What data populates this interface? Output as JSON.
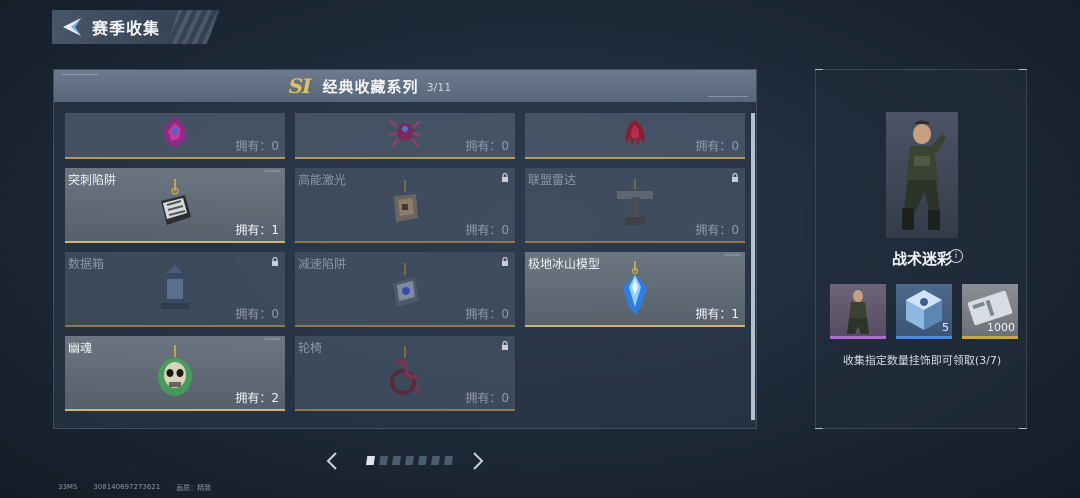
{
  "header": {
    "title": "赛季收集"
  },
  "panel": {
    "season_badge": "SI",
    "series_title": "经典收藏系列",
    "series_count": "3/11"
  },
  "cards": [
    {
      "name": "",
      "owned": "拥有：0",
      "state": "top"
    },
    {
      "name": "",
      "owned": "拥有：0",
      "state": "top"
    },
    {
      "name": "",
      "owned": "拥有：0",
      "state": "top"
    },
    {
      "name": "突刺陷阱",
      "owned": "拥有：1",
      "state": "owned"
    },
    {
      "name": "高能激光",
      "owned": "拥有：0",
      "state": "locked"
    },
    {
      "name": "联盟雷达",
      "owned": "拥有：0",
      "state": "locked"
    },
    {
      "name": "数据箱",
      "owned": "拥有：0",
      "state": "locked"
    },
    {
      "name": "减速陷阱",
      "owned": "拥有：0",
      "state": "locked"
    },
    {
      "name": "极地冰山模型",
      "owned": "拥有：1",
      "state": "owned"
    },
    {
      "name": "幽魂",
      "owned": "拥有：2",
      "state": "owned"
    },
    {
      "name": "轮椅",
      "owned": "拥有：0",
      "state": "locked"
    }
  ],
  "pagination": {
    "total_pages": 7,
    "current_page": 1
  },
  "reward": {
    "name": "战术迷彩",
    "info_label": "i",
    "items": [
      {
        "type": "skin",
        "qty": ""
      },
      {
        "type": "crate",
        "qty": "5"
      },
      {
        "type": "ticket",
        "qty": "1000"
      }
    ],
    "description": "收集指定数量挂饰即可领取(3/7)"
  },
  "footer": {
    "ping": "33MS",
    "player_id": "308140697273621",
    "quality_label": "画质：精致"
  },
  "colors": {
    "gold_accent": "#d6b469",
    "season_badge": "#e2c06a",
    "rarity_purple": "#b06ad0",
    "rarity_blue": "#4c8ed6"
  }
}
